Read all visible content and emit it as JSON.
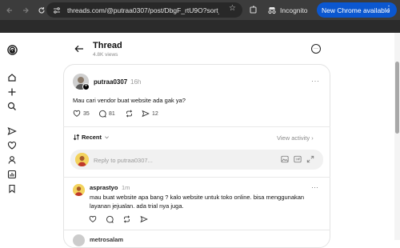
{
  "browser": {
    "url": "threads.com/@putraa0307/post/DbgF_rtU9O?sort_order...",
    "incognito_label": "Incognito",
    "update_label": "New Chrome available"
  },
  "header": {
    "title": "Thread",
    "views": "4.8K views"
  },
  "post": {
    "username": "putraa0307",
    "time": "16h",
    "text": "Mau cari vendor buat website ada gak ya?",
    "likes": "35",
    "comments": "81",
    "shares": "12"
  },
  "sort": {
    "label": "Recent",
    "view_activity": "View activity"
  },
  "reply": {
    "placeholder": "Reply to putraa0307..."
  },
  "comment": {
    "username": "asprastyo",
    "time": "1m",
    "text": "mau buat website apa bang ? kalo website untuk toko online. bisa menggunakan layanan jejualan. ada trial nya juga."
  },
  "next_comment": {
    "username": "metrosalam"
  },
  "colors": {
    "chrome_bg": "#3c3c3c",
    "update_button": "#0b57d0",
    "card_border": "#e3e3e3"
  }
}
